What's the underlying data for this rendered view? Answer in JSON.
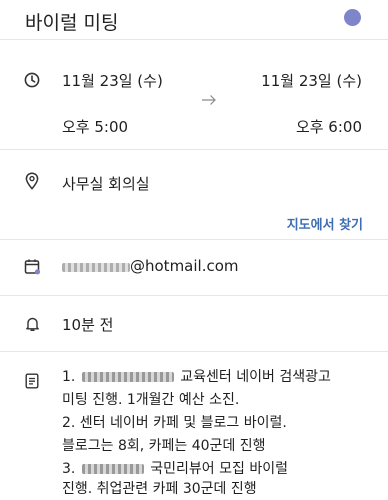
{
  "header": {
    "title": "바이럴 미팅",
    "event_color": "#7e86c9"
  },
  "time": {
    "start_date": "11월 23일 (수)",
    "start_time": "오후 5:00",
    "end_date": "11월 23일 (수)",
    "end_time": "오후 6:00"
  },
  "location": {
    "name": "사무실 회의실",
    "map_link": "지도에서 찾기",
    "link_color": "#3d6db3"
  },
  "calendar": {
    "account": "@hotmail.com"
  },
  "reminder": {
    "label": "10분 전"
  },
  "description": {
    "line1_a": "1.",
    "line1_b": "교육센터 네이버 검색광고",
    "line2": "미팅 진행. 1개월간 예산 소진.",
    "line3": "2. 센터 네이버 카페 및 블로그 바이럴.",
    "line4": "블로그는 8회, 카페는 40군데 진행",
    "line5_a": "3.",
    "line5_b": "국민리뷰어 모집 바이럴",
    "line6": "진행. 취업관련 카페 30군데 진행"
  }
}
